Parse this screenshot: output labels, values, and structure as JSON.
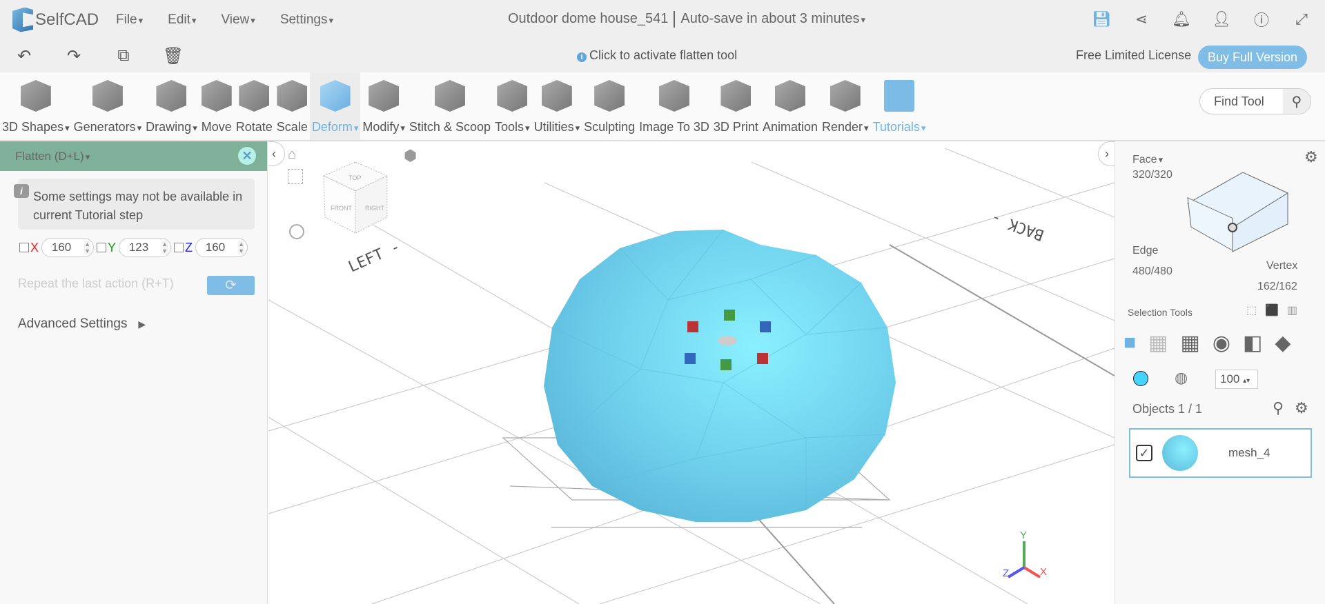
{
  "app": {
    "name": "SelfCAD",
    "menus": [
      "File",
      "Edit",
      "View",
      "Settings"
    ],
    "doc_title": "Outdoor dome house_541",
    "autosave": "Auto-save in about 3 minutes"
  },
  "top_icons": [
    "save-icon",
    "share-icon",
    "bell-icon",
    "user-icon",
    "info-icon",
    "fullscreen-icon"
  ],
  "row2": {
    "hint": "Click to activate flatten tool",
    "license": "Free Limited License",
    "buy": "Buy Full Version"
  },
  "toolbar": [
    {
      "label": "3D Shapes",
      "dd": true
    },
    {
      "label": "Generators",
      "dd": true
    },
    {
      "label": "Drawing",
      "dd": true
    },
    {
      "label": "Move"
    },
    {
      "label": "Rotate"
    },
    {
      "label": "Scale"
    },
    {
      "label": "Deform",
      "dd": true,
      "active": true
    },
    {
      "label": "Modify",
      "dd": true
    },
    {
      "label": "Stitch & Scoop"
    },
    {
      "label": "Tools",
      "dd": true
    },
    {
      "label": "Utilities",
      "dd": true
    },
    {
      "label": "Sculpting"
    },
    {
      "label": "Image To 3D"
    },
    {
      "label": "3D Print"
    },
    {
      "label": "Animation"
    },
    {
      "label": "Render",
      "dd": true
    },
    {
      "label": "Tutorials",
      "dd": true,
      "blue": true
    }
  ],
  "find_tool": "Find Tool",
  "panel": {
    "title": "Flatten (D+L)",
    "note": "Some settings may not be available in current Tutorial step",
    "x_label": "X",
    "x": "160",
    "y_label": "Y",
    "y": "123",
    "z_label": "Z",
    "z": "160",
    "repeat": "Repeat the last action (R+T)",
    "advanced": "Advanced Settings"
  },
  "viewport": {
    "cube": {
      "top": "TOP",
      "front": "FRONT",
      "right": "RIGHT"
    },
    "left_label": "LEFT -",
    "back_label": "BACK -",
    "axes": {
      "x": "X",
      "y": "Y",
      "z": "Z"
    },
    "mesh_color": "#6fd0ec"
  },
  "right": {
    "face": "Face",
    "face_count": "320/320",
    "edge": "Edge",
    "edge_count": "480/480",
    "vertex": "Vertex",
    "vertex_count": "162/162",
    "selection_tools": "Selection Tools",
    "opacity": "100",
    "color": "#45d4ff",
    "objects": "Objects 1 / 1",
    "object_name": "mesh_4"
  }
}
